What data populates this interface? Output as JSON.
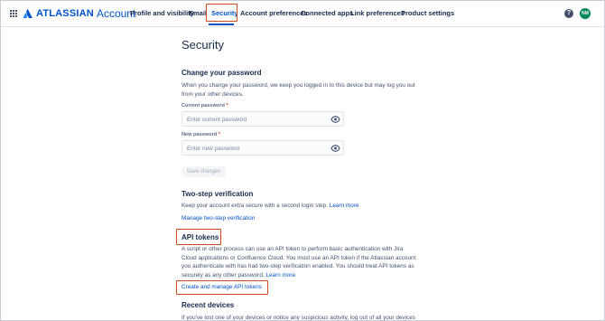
{
  "header": {
    "logo_word": "ATLASSIAN",
    "logo_product": "Account",
    "nav": [
      {
        "label": "Profile and visibility"
      },
      {
        "label": "Email"
      },
      {
        "label": "Security"
      },
      {
        "label": "Account preferences"
      },
      {
        "label": "Connected apps"
      },
      {
        "label": "Link preferences"
      },
      {
        "label": "Product settings"
      }
    ],
    "help_glyph": "?",
    "avatar_initials": "NM",
    "accent_color": "#0052cc",
    "highlight_color": "#d04a1f"
  },
  "page": {
    "title": "Security",
    "change_password": {
      "heading": "Change your password",
      "description": "When you change your password, we keep you logged in to this device but may log you out from your other devices.",
      "current_label": "Current password",
      "current_placeholder": "Enter current password",
      "new_label": "New password",
      "new_placeholder": "Enter new password",
      "required_mark": "*",
      "save_button": "Save changes"
    },
    "two_step": {
      "heading": "Two-step verification",
      "description": "Keep your account extra secure with a second login step.",
      "learn_more": "Learn more",
      "manage_link": "Manage two-step verification"
    },
    "api_tokens": {
      "heading": "API tokens",
      "description": "A script or other process can use an API token to perform basic authentication with Jira Cloud applications or Confluence Cloud. You must use an API token if the Atlassian account you authenticate with has had two-step verification enabled. You should treat API tokens as securely as any other password.",
      "learn_more": "Learn more",
      "manage_link": "Create and manage API tokens"
    },
    "recent_devices": {
      "heading": "Recent devices",
      "description": "If you've lost one of your devices or notice any suspicious activity, log out of all your devices"
    }
  }
}
